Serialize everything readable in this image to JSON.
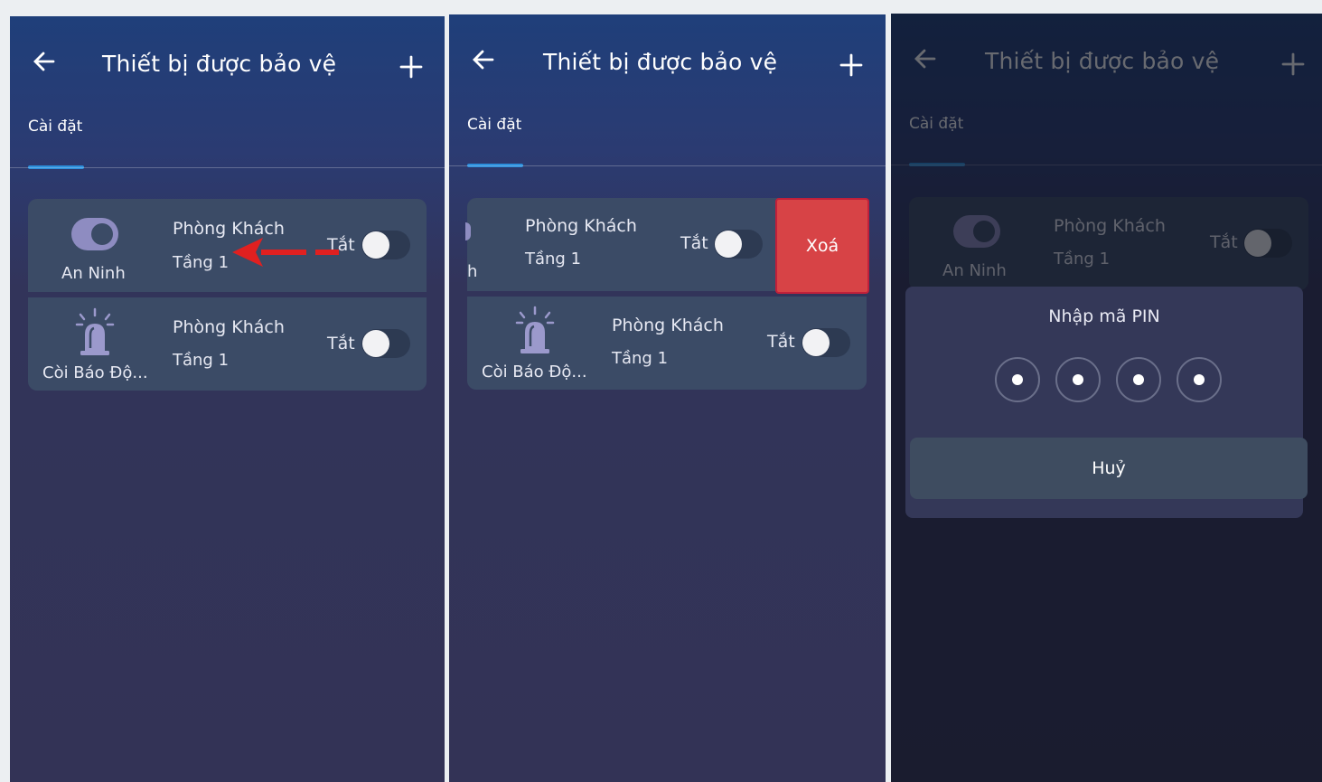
{
  "header": {
    "title": "Thiết bị được bảo vệ",
    "tab": "Cài đặt"
  },
  "devices": [
    {
      "name": "An Ninh",
      "icon": "shield-toggle-icon",
      "room": "Phòng Khách",
      "floor": "Tầng 1",
      "state": "Tắt"
    },
    {
      "name": "Còi Báo Độ...",
      "icon": "siren-icon",
      "room": "Phòng Khách",
      "floor": "Tầng 1",
      "state": "Tắt"
    }
  ],
  "swipe": {
    "delete_label": "Xoá",
    "clipped_name": "h"
  },
  "pin": {
    "title": "Nhập mã PIN",
    "cancel_label": "Huỷ",
    "digits_entered": 4
  },
  "colors": {
    "accent": "#2c8fdc",
    "delete": "#d74346",
    "swipe_arrow": "#e02020",
    "card": "#3b4b66"
  }
}
